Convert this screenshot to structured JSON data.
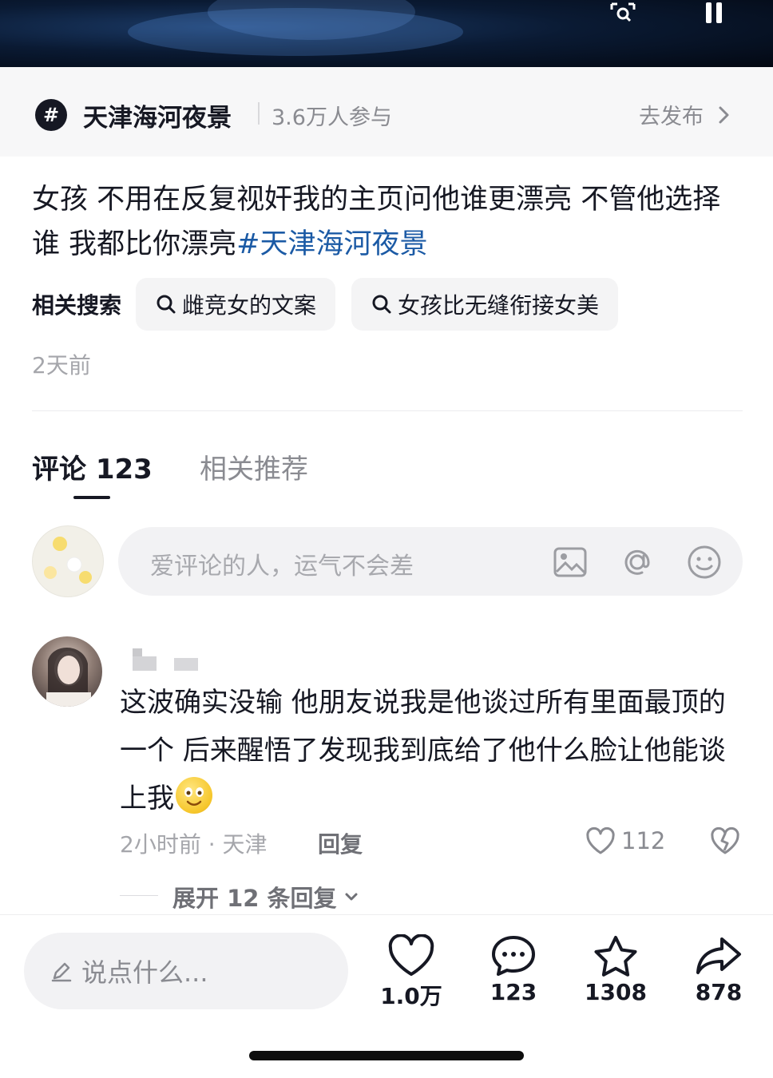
{
  "topic": {
    "badge": "#",
    "name": "天津海河夜景",
    "participants": "3.6万人参与",
    "go_publish": "去发布"
  },
  "caption": {
    "text": "女孩 不用在反复视奸我的主页问他谁更漂亮 不管他选择谁 我都比你漂亮",
    "hashtag": "#天津海河夜景"
  },
  "related_search": {
    "label": "相关搜索",
    "items": [
      {
        "text": "雌竞女的文案"
      },
      {
        "text": "女孩比无缝衔接女美"
      }
    ]
  },
  "post_time": "2天前",
  "tabs": [
    {
      "label": "评论 123"
    },
    {
      "label": "相关推荐"
    }
  ],
  "comment_input": {
    "placeholder": "爱评论的人，运气不会差"
  },
  "comment": {
    "text": "这波确实没输 他朋友说我是他谈过所有里面最顶的一个 后来醒悟了发现我到底给了他什么脸让他能谈上我",
    "meta": "2小时前 · 天津",
    "reply_label": "回复",
    "likes": "112",
    "expand_label": "展开 12 条回复"
  },
  "bottom_bar": {
    "say_placeholder": "说点什么...",
    "likes": "1.0万",
    "comments": "123",
    "favorites": "1308",
    "shares": "878"
  }
}
